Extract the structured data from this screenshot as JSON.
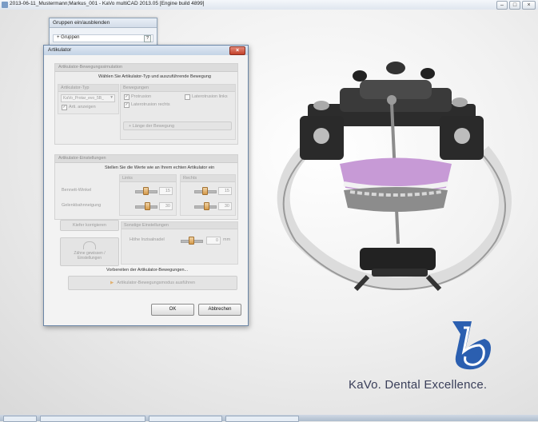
{
  "window": {
    "title": "2013-06-11_Mustermann;Markus_001 - KaVo multiCAD 2013.05 [Engine build 4899]",
    "minimize": "–",
    "maximize": "□",
    "close": "×"
  },
  "groups_panel": {
    "title": "Gruppen ein/ausblenden",
    "row_label": "+ Gruppen",
    "help": "?"
  },
  "dialog": {
    "title": "Artikulator",
    "close": "×",
    "sim_section": {
      "header": "Artikulator-Bewegungssimulation",
      "instruction": "Wählen Sie Artikulator-Typ und auszuführende Bewegung",
      "type_header": "Artikulator-Typ",
      "type_value": "KaVo_Protar_evo_5B_",
      "show_checkbox": "Arti. anzeigen",
      "movements_header": "Bewegungen",
      "protrusion": "Protrusion",
      "laterotrusion_left": "Laterotrusion links",
      "laterotrusion_right": "Laterotrusion rechts",
      "length_button": "+ Länge der Bewegung"
    },
    "settings_section": {
      "header": "Artikulator-Einstellungen",
      "instruction": "Stellen Sie die Werte wie an Ihrem echten Artikulator ein",
      "col_left": "Links",
      "col_right": "Rechts",
      "bennett_label": "Bennett-Winkel",
      "bennett_left": "15",
      "bennett_right": "15",
      "condylar_label": "Gelenkbahnneigung",
      "condylar_left": "30",
      "condylar_right": "30"
    },
    "adjust_button": "Kiefer korrigieren",
    "reset_button_line1": "Zähne gewissen /",
    "reset_button_line2": "Einstellungen",
    "other_header": "Sonstige Einstellungen",
    "pin_label": "Höhe Inzisalnadel",
    "pin_value": "0",
    "pin_unit": "mm",
    "prepare_label": "Vorbereiten der Artikulator-Bewegungen...",
    "run_button": "Artikulator-Bewegungsmodus ausführen",
    "ok": "OK",
    "cancel": "Abbrechen"
  },
  "branding": {
    "tagline": "KaVo. Dental Excellence."
  },
  "colors": {
    "logo_blue": "#2b5fb0",
    "teeth_pink": "#c79ad6",
    "slider_orange": "#d59a4a"
  }
}
